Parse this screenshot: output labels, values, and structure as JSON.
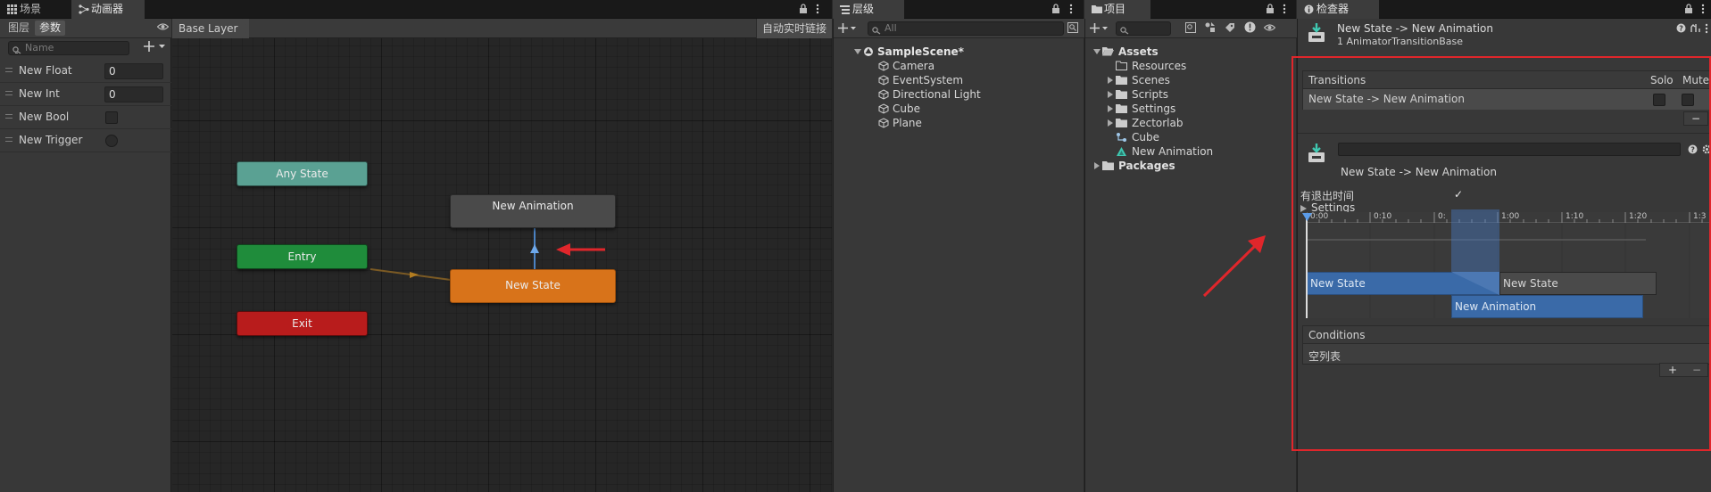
{
  "colors": {
    "accent_red": "#e0262b",
    "any_state": "#5aa193",
    "entry": "#1f8c3b",
    "exit": "#b81c1c",
    "new_state": "#d8731a",
    "new_animation": "#4a4a4a",
    "timeline_blue": "#3a6aa8"
  },
  "animator_tabs": [
    {
      "label": "场景",
      "icon": "grid-icon"
    },
    {
      "label": "动画器",
      "icon": "animator-icon"
    }
  ],
  "params": {
    "tabs": [
      "图层",
      "参数"
    ],
    "search_placeholder": "Name",
    "items": [
      {
        "name": "New Float",
        "value": "0"
      },
      {
        "name": "New Int",
        "value": "0"
      },
      {
        "name": "New Bool",
        "value": ""
      },
      {
        "name": "New Trigger",
        "value": ""
      }
    ]
  },
  "graph": {
    "breadcrumb": "Base Layer",
    "live_link": "自动实时链接",
    "nodes": {
      "any_state": "Any State",
      "entry": "Entry",
      "exit": "Exit",
      "new_animation": "New Animation",
      "new_state": "New State"
    }
  },
  "hierarchy": {
    "tab": "层级",
    "search_placeholder": "All",
    "scene": "SampleScene*",
    "items": [
      "Camera",
      "EventSystem",
      "Directional Light",
      "Cube",
      "Plane"
    ]
  },
  "project": {
    "tab": "项目",
    "assets": "Assets",
    "folders": [
      "Resources",
      "Scenes",
      "Scripts",
      "Settings",
      "Zectorlab"
    ],
    "files": [
      "Cube",
      "New Animation"
    ],
    "packages": "Packages"
  },
  "inspector": {
    "tab": "检查器",
    "title": "New State -> New Animation",
    "subtitle": "1 AnimatorTransitionBase",
    "transitions_label": "Transitions",
    "solo": "Solo",
    "mute": "Mute",
    "transition_item": "New State -> New Animation",
    "minus": "−",
    "plus": "+",
    "transition_name": "New State -> New Animation",
    "has_exit_time": "有退出时间",
    "has_exit_time_checked": "✓",
    "settings": "Settings",
    "timeline_ticks": [
      "0:00",
      "0:10",
      "0:",
      "1:00",
      "1:10",
      "1:20",
      "1:3"
    ],
    "track_from": "New State",
    "track_from_2": "New State",
    "track_to": "New Animation",
    "conditions_label": "Conditions",
    "conditions_empty": "空列表"
  }
}
